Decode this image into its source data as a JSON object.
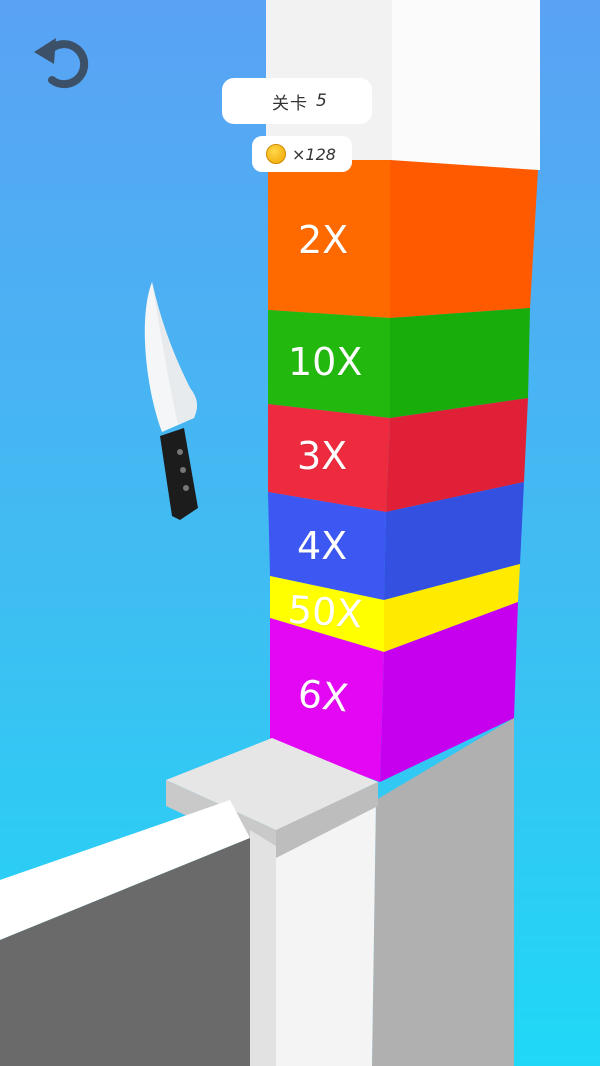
{
  "hud": {
    "level_label": "关卡",
    "level_number": "5",
    "coin_count": "×128"
  },
  "tower": {
    "blocks": [
      {
        "label": "2X",
        "front": "#ff6a00",
        "side": "#ff5a00"
      },
      {
        "label": "10X",
        "front": "#22b80e",
        "side": "#18ad0b"
      },
      {
        "label": "3X",
        "front": "#ee2a3e",
        "side": "#e02037"
      },
      {
        "label": "4X",
        "front": "#3c57f2",
        "side": "#3350e0"
      },
      {
        "label": "50X",
        "front": "#ffff00",
        "side": "#ffea00"
      },
      {
        "label": "6X",
        "front": "#e307f4",
        "side": "#c600ef"
      }
    ]
  },
  "icons": {
    "restart": "restart-icon",
    "coin": "coin-icon",
    "knife": "knife-icon"
  }
}
